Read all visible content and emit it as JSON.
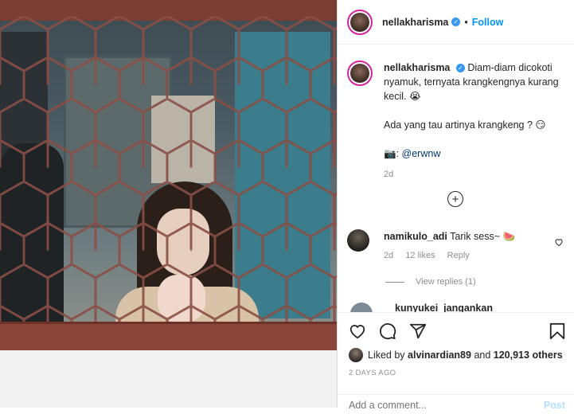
{
  "post": {
    "username": "nellakharisma",
    "follow_label": "Follow",
    "caption_line1": "Diam-diam dicokoti nyamuk, ternyata krangkengnya kurang kecil. 😭",
    "caption_line2": "Ada yang tau artinya krangkeng ? 😏",
    "caption_credit_icon": "📷",
    "caption_credit": "@erwnw",
    "caption_time": "2d"
  },
  "comments": [
    {
      "username": "namikulo_adi",
      "text": "Tarik sess~ 🍉",
      "time": "2d",
      "likes": "12 likes",
      "reply_label": "Reply",
      "view_replies": "View replies (1)"
    },
    {
      "username": "kunyukei_jangankan"
    }
  ],
  "actions": {
    "liked_by_prefix": "Liked by",
    "liked_by_user": "alvinardian89",
    "liked_by_and": "and",
    "liked_by_count": "120,913 others",
    "time_ago": "2 DAYS AGO",
    "comment_placeholder": "Add a comment...",
    "post_label": "Post"
  },
  "icons": {
    "verified": "verified-badge-icon",
    "load_more": "plus-circle-icon",
    "like": "heart-icon",
    "comment": "comment-icon",
    "share": "paper-plane-icon",
    "save": "bookmark-icon"
  },
  "colors": {
    "accent": "#0095f6",
    "verified": "#3897f0",
    "text": "#262626",
    "muted": "#8e8e8e"
  }
}
